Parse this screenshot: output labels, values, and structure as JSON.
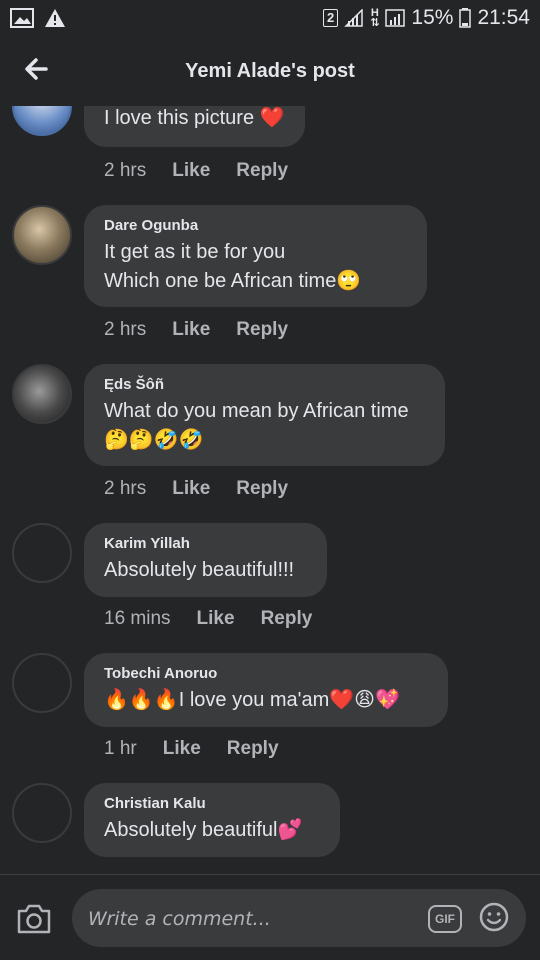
{
  "status_bar": {
    "sim_label": "2",
    "network_label": "H",
    "battery": "15%",
    "time": "21:54"
  },
  "header": {
    "title": "Yemi Alade's post"
  },
  "comments": [
    {
      "author": "",
      "lines": [
        "I love this picture ❤️"
      ],
      "time": "2 hrs",
      "like_label": "Like",
      "reply_label": "Reply"
    },
    {
      "author": "Dare Ogunba",
      "lines": [
        "It get as it be for you",
        "Which one be African time🙄"
      ],
      "time": "2 hrs",
      "like_label": "Like",
      "reply_label": "Reply"
    },
    {
      "author": "Ęds Šôñ",
      "lines": [
        "What do you mean by African time",
        "🤔🤔🤣🤣"
      ],
      "time": "2 hrs",
      "like_label": "Like",
      "reply_label": "Reply"
    },
    {
      "author": "Karim Yillah",
      "lines": [
        "Absolutely beautiful!!!"
      ],
      "time": "16 mins",
      "like_label": "Like",
      "reply_label": "Reply"
    },
    {
      "author": "Tobechi Anoruo",
      "lines": [
        "🔥🔥🔥I love you ma'am❤️😩💖"
      ],
      "time": "1 hr",
      "like_label": "Like",
      "reply_label": "Reply"
    },
    {
      "author": "Christian Kalu",
      "lines": [
        "Absolutely beautiful💕"
      ],
      "time": "",
      "like_label": "",
      "reply_label": ""
    }
  ],
  "composer": {
    "placeholder": "Write a comment...",
    "gif_label": "GIF"
  },
  "colors": {
    "background": "#242526",
    "bubble": "#3a3b3c",
    "text": "#e4e6eb",
    "secondary_text": "#b0b3b8",
    "heart": "#e0245e"
  }
}
